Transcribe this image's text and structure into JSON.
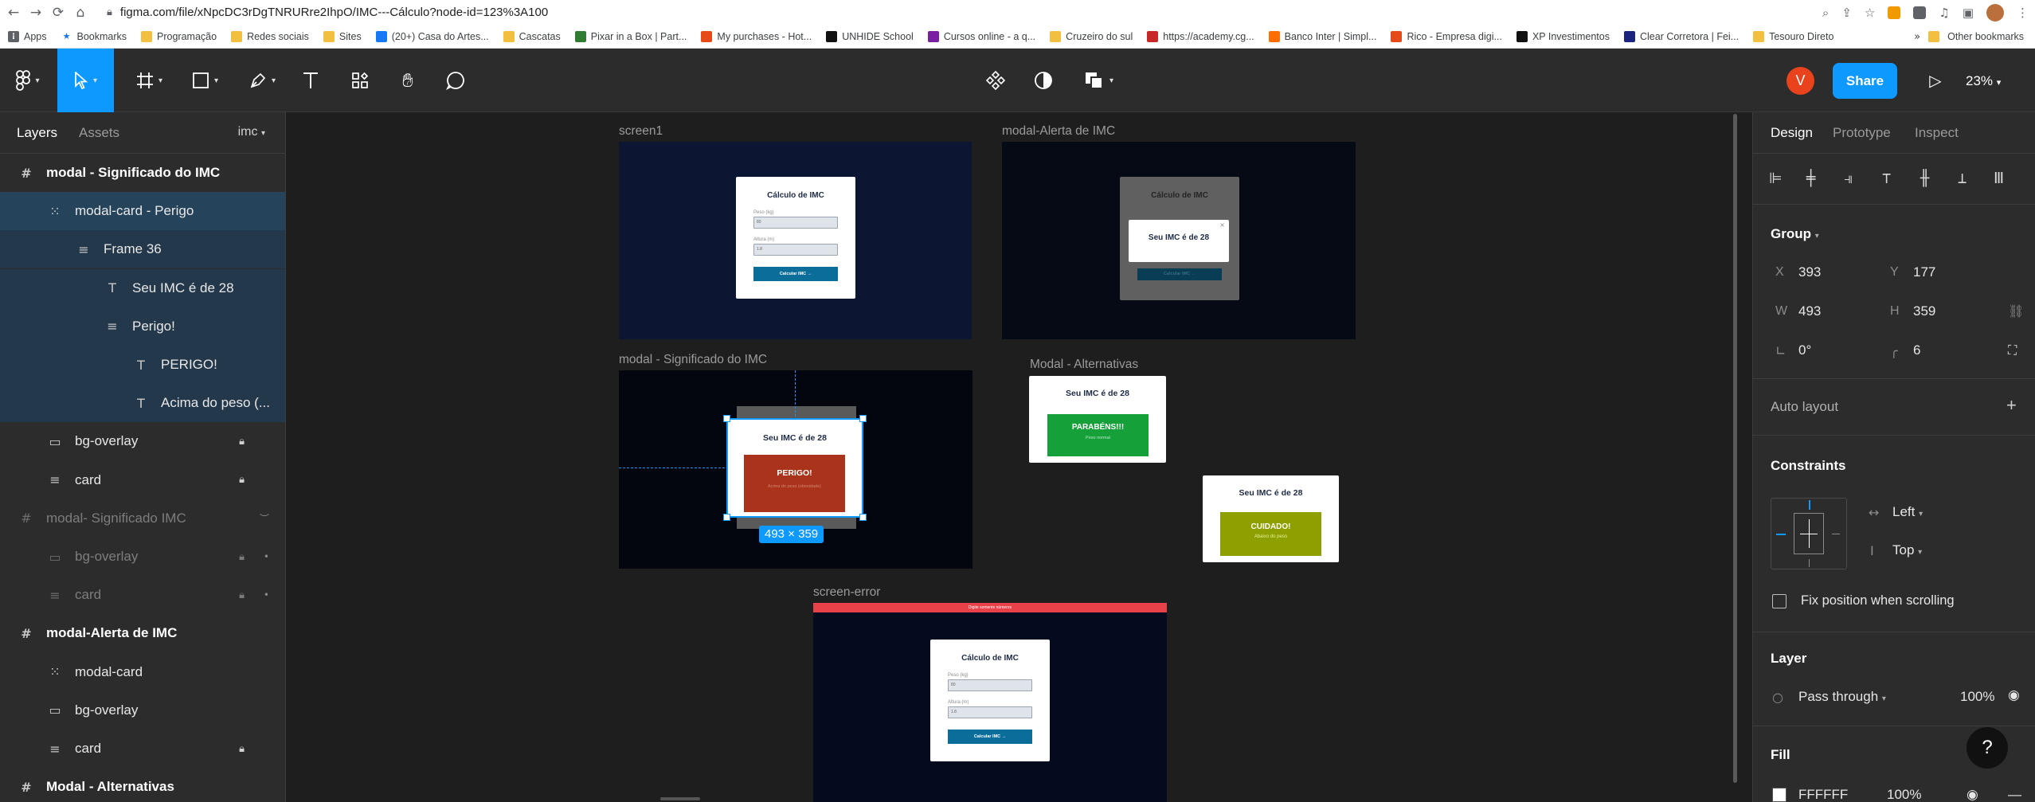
{
  "browser": {
    "url": "figma.com/file/xNpcDC3rDgTNRURre2IhpO/IMC---Cálculo?node-id=123%3A100",
    "bookmarks": [
      "Apps",
      "Bookmarks",
      "Programação",
      "Redes sociais",
      "Sites",
      "(20+) Casa do Artes...",
      "Cascatas",
      "Pixar in a Box | Part...",
      "My purchases - Hot...",
      "UNHIDE School",
      "Cursos online - a q...",
      "Cruzeiro do sul",
      "https://academy.cg...",
      "Banco Inter | Simpl...",
      "Rico - Empresa digi...",
      "XP Investimentos",
      "Clear Corretora | Fei...",
      "Tesouro Direto"
    ],
    "other_bookmarks": "Other bookmarks"
  },
  "toolbar": {
    "icons": [
      "figma-menu-icon",
      "move-tool-icon",
      "frame-tool-icon",
      "rectangle-tool-icon",
      "pen-tool-icon",
      "text-tool-icon",
      "resources-icon",
      "hand-tool-icon",
      "comment-icon",
      "component-icon",
      "contrast-icon",
      "boolean-icon"
    ],
    "avatar_initial": "V",
    "share_label": "Share",
    "zoom_label": "23%",
    "accent": "#0d99ff"
  },
  "left_panel": {
    "tab_layers": "Layers",
    "tab_assets": "Assets",
    "page_name": "imc",
    "layers": [
      {
        "name": "modal - Significado do IMC",
        "icon": "#",
        "indent": 0,
        "style": "bold"
      },
      {
        "name": "modal-card - Perigo",
        "icon": "⁙",
        "indent": 1,
        "style": "selected"
      },
      {
        "name": "Frame 36",
        "icon": "≡",
        "indent": 2,
        "style": "child"
      },
      {
        "name": "Seu IMC é de 28",
        "icon": "T",
        "indent": 3,
        "style": "child"
      },
      {
        "name": "Perigo!",
        "icon": "≡",
        "indent": 3,
        "style": "child"
      },
      {
        "name": "PERIGO!",
        "icon": "T",
        "indent": 4,
        "style": "child"
      },
      {
        "name": "Acima do peso (...",
        "icon": "T",
        "indent": 4,
        "style": "child"
      },
      {
        "name": "bg-overlay",
        "icon": "▭",
        "indent": 1,
        "style": "normal",
        "locked": true
      },
      {
        "name": "card",
        "icon": "≡",
        "indent": 1,
        "style": "normal",
        "locked": true
      },
      {
        "name": "modal- Significado IMC",
        "icon": "#",
        "indent": 0,
        "style": "dim",
        "hidden": true
      },
      {
        "name": "bg-overlay",
        "icon": "▭",
        "indent": 1,
        "style": "dim",
        "locked": true,
        "dot": true
      },
      {
        "name": "card",
        "icon": "≡",
        "indent": 1,
        "style": "dim",
        "locked": true,
        "dot": true
      },
      {
        "name": "modal-Alerta de IMC",
        "icon": "#",
        "indent": 0,
        "style": "bold"
      },
      {
        "name": "modal-card",
        "icon": "⁙",
        "indent": 1,
        "style": "normal"
      },
      {
        "name": "bg-overlay",
        "icon": "▭",
        "indent": 1,
        "style": "normal"
      },
      {
        "name": "card",
        "icon": "≡",
        "indent": 1,
        "style": "normal",
        "locked": true
      },
      {
        "name": "Modal - Alternativas",
        "icon": "#",
        "indent": 0,
        "style": "bold"
      }
    ]
  },
  "canvas": {
    "frames": {
      "screen1": "screen1",
      "alerta": "modal-Alerta de IMC",
      "significado": "modal - Significado do IMC",
      "alternativas": "Modal - Alternativas",
      "error": "screen-error"
    },
    "calc_title": "Cálculo de IMC",
    "weight_label": "Peso (kg)",
    "height_label": "Altura (m)",
    "weight_value": "80",
    "height_value": "1.8",
    "calc_button": "Calcular IMC  →",
    "result_title": "Seu IMC é de 28",
    "perigo_title": "PERIGO!",
    "perigo_sub": "Acima do peso (obesidade)",
    "parabens_title": "PARABÉNS!!!",
    "parabens_sub": "Peso normal",
    "cuidado_title": "CUIDADO!",
    "cuidado_sub": "Abaixo do peso",
    "error_bar_text": "Digite somente números",
    "selection_size": "493 × 359",
    "colors": {
      "perigo": "#a9341b",
      "parabens": "#16a03a",
      "cuidado": "#8da000",
      "error": "#e8414a",
      "teal": "#0b6e9a",
      "selection": "#0d99ff"
    }
  },
  "right_panel": {
    "tab_design": "Design",
    "tab_prototype": "Prototype",
    "tab_inspect": "Inspect",
    "group_label": "Group",
    "x_label": "X",
    "x_value": "393",
    "y_label": "Y",
    "y_value": "177",
    "w_label": "W",
    "w_value": "493",
    "h_label": "H",
    "h_value": "359",
    "rotation_value": "0°",
    "radius_value": "6",
    "auto_layout": "Auto layout",
    "constraints": "Constraints",
    "constraint_h": "Left",
    "constraint_v": "Top",
    "fix_position": "Fix position when scrolling",
    "layer": "Layer",
    "blend_mode": "Pass through",
    "opacity": "100%",
    "fill": "Fill",
    "fill_value": "FFFFFF",
    "fill_opacity": "100%",
    "help": "?"
  }
}
